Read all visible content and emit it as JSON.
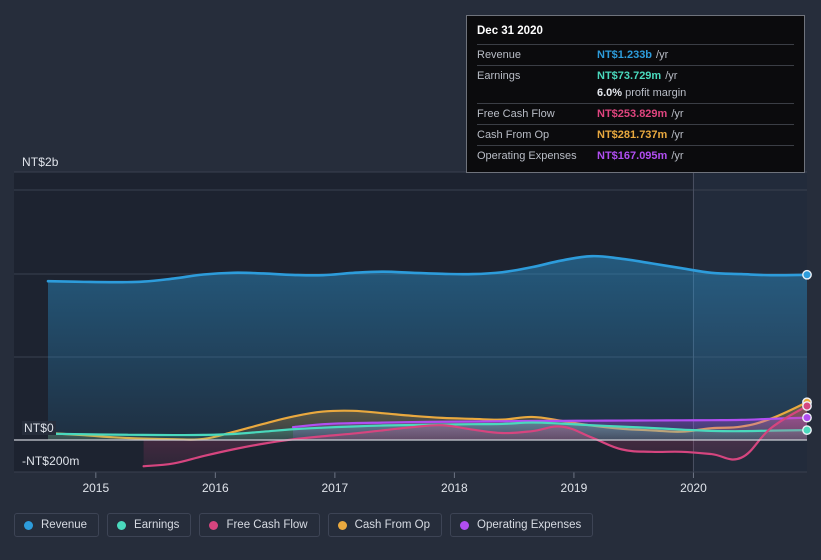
{
  "theme": {
    "page_bg": "#262d3b",
    "plot_bg": "#1d2330",
    "plot_bg_forecast": "#222a38",
    "gridline": "#39404f",
    "zero_line": "#c9ccd4"
  },
  "tooltip": {
    "date": "Dec 31 2020",
    "rows": [
      {
        "label": "Revenue",
        "value": "NT$1.233b",
        "unit": "/yr",
        "color": "#2d9cdb"
      },
      {
        "label": "Earnings",
        "value": "NT$73.729m",
        "unit": "/yr",
        "color": "#4ad9bd"
      },
      {
        "label": "",
        "sub_value": "6.0%",
        "sub_text": "profit margin"
      },
      {
        "label": "Free Cash Flow",
        "value": "NT$253.829m",
        "unit": "/yr",
        "color": "#e0457f"
      },
      {
        "label": "Cash From Op",
        "value": "NT$281.737m",
        "unit": "/yr",
        "color": "#e9a93f"
      },
      {
        "label": "Operating Expenses",
        "value": "NT$167.095m",
        "unit": "/yr",
        "color": "#b14ef2"
      }
    ]
  },
  "legend": {
    "items": [
      {
        "label": "Revenue",
        "color": "#2d9cdb"
      },
      {
        "label": "Earnings",
        "color": "#4ad9bd"
      },
      {
        "label": "Free Cash Flow",
        "color": "#d6457f"
      },
      {
        "label": "Cash From Op",
        "color": "#e9a93f"
      },
      {
        "label": "Operating Expenses",
        "color": "#b14ef2"
      }
    ]
  },
  "chart_data": {
    "type": "area",
    "title": "",
    "xlabel": "",
    "ylabel": "",
    "currency": "NT$",
    "grid": true,
    "legend_position": "bottom",
    "y_axis_labels": [
      "NT$2b",
      "NT$0",
      "-NT$200m"
    ],
    "y_axis_values": [
      2000,
      0,
      -200
    ],
    "ylim": [
      -200,
      2200
    ],
    "x_tick_labels": [
      "2015",
      "2016",
      "2017",
      "2018",
      "2019",
      "2020"
    ],
    "x": [
      2014.6,
      2014.9,
      2015.15,
      2015.4,
      2015.65,
      2015.9,
      2016.15,
      2016.4,
      2016.65,
      2016.9,
      2017.15,
      2017.4,
      2017.65,
      2017.9,
      2018.15,
      2018.4,
      2018.65,
      2018.9,
      2019.15,
      2019.4,
      2019.65,
      2019.9,
      2020.15,
      2020.4,
      2020.65,
      2020.95
    ],
    "series": [
      {
        "name": "Revenue",
        "color": "#2d9cdb",
        "unit": "NT$m",
        "last_value": 1233,
        "values": [
          1185,
          1180,
          1178,
          1182,
          1205,
          1235,
          1248,
          1243,
          1232,
          1230,
          1247,
          1256,
          1248,
          1240,
          1238,
          1252,
          1290,
          1340,
          1372,
          1352,
          1318,
          1282,
          1248,
          1238,
          1230,
          1233
        ]
      },
      {
        "name": "Earnings",
        "color": "#4ad9bd",
        "unit": "NT$m",
        "last_value": 73.729,
        "values": [
          47,
          43,
          40,
          38,
          37,
          38,
          45,
          62,
          80,
          92,
          101,
          108,
          112,
          115,
          118,
          120,
          130,
          122,
          110,
          100,
          90,
          78,
          68,
          66,
          70,
          73.729
        ]
      },
      {
        "name": "Free Cash Flow",
        "color": "#d6457f",
        "unit": "NT$m",
        "last_value": 253.829,
        "values": [
          null,
          null,
          null,
          -196,
          -175,
          -120,
          -70,
          -28,
          5,
          28,
          48,
          72,
          96,
          110,
          78,
          52,
          66,
          100,
          18,
          -70,
          -88,
          -88,
          -105,
          -132,
          90,
          253.829
        ]
      },
      {
        "name": "Cash From Op",
        "color": "#e9a93f",
        "unit": "NT$m",
        "last_value": 281.737,
        "values": [
          52,
          36,
          20,
          10,
          6,
          8,
          60,
          120,
          175,
          212,
          218,
          200,
          180,
          165,
          158,
          152,
          172,
          142,
          108,
          84,
          72,
          62,
          88,
          100,
          160,
          281.737
        ]
      },
      {
        "name": "Operating Expenses",
        "color": "#b14ef2",
        "unit": "NT$m",
        "last_value": 167.095,
        "values": [
          null,
          null,
          null,
          null,
          null,
          null,
          null,
          null,
          96,
          118,
          126,
          130,
          134,
          136,
          138,
          140,
          142,
          143,
          144,
          145,
          146,
          147,
          148,
          150,
          158,
          167.095
        ]
      }
    ],
    "forecast_boundary_x": 2020.0,
    "endpoint_markers": true
  }
}
